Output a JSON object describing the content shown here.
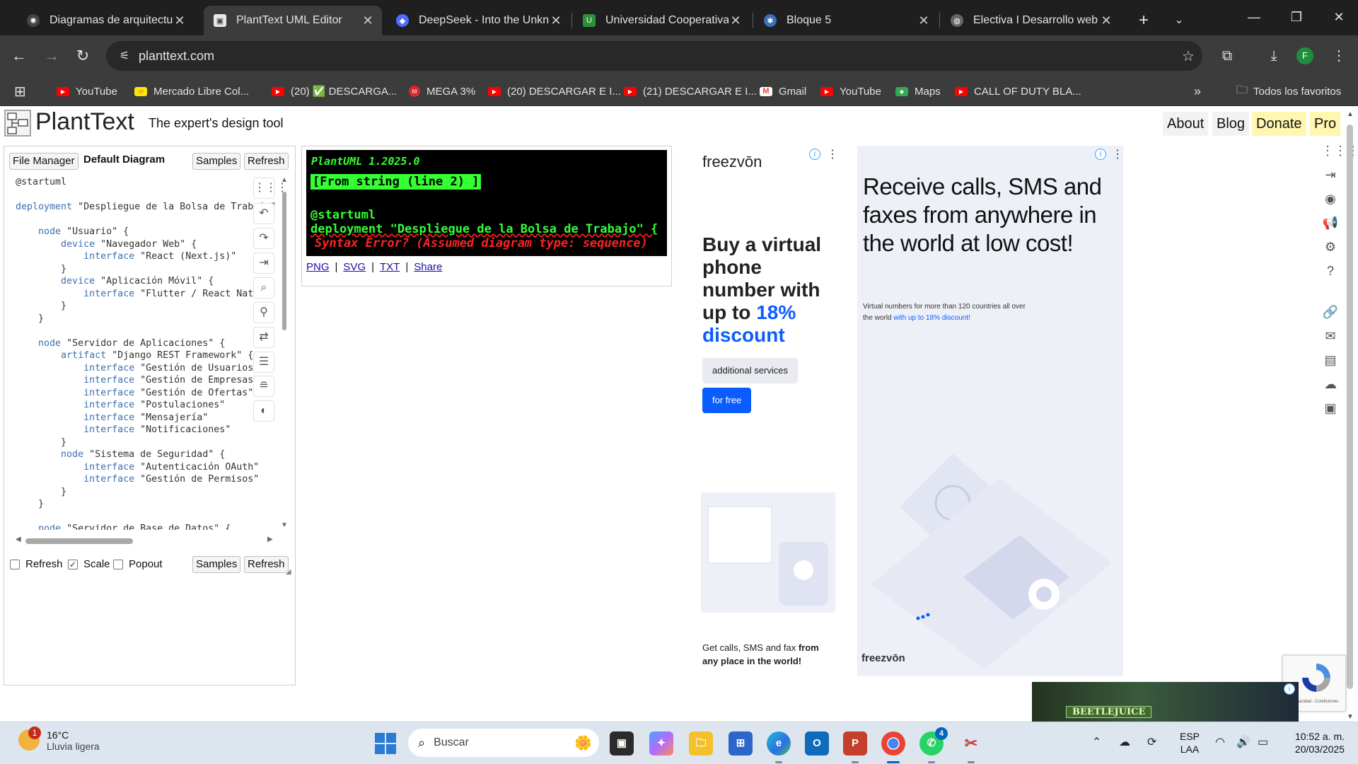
{
  "browser": {
    "tabs": [
      {
        "title": "Diagramas de arquitectura",
        "active": false
      },
      {
        "title": "PlantText UML Editor",
        "active": true
      },
      {
        "title": "DeepSeek - Into the Unknown",
        "active": false
      },
      {
        "title": "Universidad Cooperativa de Colombia",
        "active": false
      },
      {
        "title": "Bloque 5",
        "active": false
      },
      {
        "title": "Electiva I Desarrollo web",
        "active": false
      }
    ],
    "url": "planttext.com",
    "profile_initial": "F",
    "bookmarks": [
      {
        "label": "YouTube",
        "icon": "youtube-icon"
      },
      {
        "label": "Mercado Libre Col...",
        "icon": "mercadolibre-icon"
      },
      {
        "label": "(20) ✅ DESCARGA...",
        "icon": "youtube-icon"
      },
      {
        "label": "MEGA 3%",
        "icon": "mega-icon"
      },
      {
        "label": "(20) DESCARGAR E I...",
        "icon": "youtube-icon"
      },
      {
        "label": "(21) DESCARGAR E I...",
        "icon": "youtube-icon"
      },
      {
        "label": "Gmail",
        "icon": "gmail-icon"
      },
      {
        "label": "YouTube",
        "icon": "youtube-icon"
      },
      {
        "label": "Maps",
        "icon": "maps-icon"
      },
      {
        "label": "CALL OF DUTY BLA...",
        "icon": "youtube-icon"
      }
    ],
    "all_bookmarks": "Todos los favoritos"
  },
  "site": {
    "brand": "PlantText",
    "tagline": "The expert's design tool",
    "nav": [
      "About",
      "Blog",
      "Donate",
      "Pro"
    ]
  },
  "editor": {
    "file_manager": "File Manager",
    "diagram_name": "Default Diagram",
    "samples": "Samples",
    "refresh": "Refresh",
    "code_lines": [
      "@startuml",
      "",
      "deployment \"Despliegue de la Bolsa de Trabajo\" {",
      "",
      "    node \"Usuario\" {",
      "        device \"Navegador Web\" {",
      "            interface \"React (Next.js)\"",
      "        }",
      "        device \"Aplicación Móvil\" {",
      "            interface \"Flutter / React Native\"",
      "        }",
      "    }",
      "",
      "    node \"Servidor de Aplicaciones\" {",
      "        artifact \"Django REST Framework\" {",
      "            interface \"Gestión de Usuarios\"",
      "            interface \"Gestión de Empresas\"",
      "            interface \"Gestión de Ofertas\"",
      "            interface \"Postulaciones\"",
      "            interface \"Mensajería\"",
      "            interface \"Notificaciones\"",
      "        }",
      "        node \"Sistema de Seguridad\" {",
      "            interface \"Autenticación OAuth\"",
      "            interface \"Gestión de Permisos\"",
      "        }",
      "    }",
      "",
      "    node \"Servidor de Base de Datos\" {"
    ],
    "checkboxes": [
      {
        "label": "Refresh",
        "checked": false
      },
      {
        "label": "Scale",
        "checked": true
      },
      {
        "label": "Popout",
        "checked": false
      }
    ],
    "bottom_samples": "Samples",
    "bottom_refresh": "Refresh"
  },
  "output": {
    "version": "PlantUML 1.2025.0",
    "source": "[From string (line 2) ]",
    "line1": "@startuml",
    "line2": "deployment \"Despliegue de la Bolsa de Trabajo\" {",
    "line3": " Syntax Error? (Assumed diagram type: sequence)",
    "links": [
      "PNG",
      "SVG",
      "TXT",
      "Share"
    ]
  },
  "ads": {
    "ad1": {
      "brand": "freezvōn",
      "headline": "Buy a virtual phone number with up to",
      "headline_accent": "18% discount",
      "btn1": "additional services",
      "btn2": "for free",
      "footer_plain": "Get calls, SMS and fax ",
      "footer_bold": "from any place in the world!"
    },
    "ad2": {
      "headline": "Receive calls, SMS and faxes from anywhere in the world at low cost!",
      "sub_plain": "Virtual numbers for more than 120 countries all over the world ",
      "sub_accent": "with up to 18% discount!",
      "brand": "freezvōn"
    },
    "banner_text": "BEETLEJUICE",
    "recaptcha_text": "Privacidad - Condiciones"
  },
  "taskbar": {
    "temperature": "16°C",
    "weather": "Lluvia ligera",
    "weather_badge": "1",
    "search_placeholder": "Buscar",
    "lang_line1": "ESP",
    "lang_line2": "LAA",
    "time": "10:52 a. m.",
    "date": "20/03/2025",
    "whatsapp_badge": "4"
  },
  "colors": {
    "accent_blue": "#0b5cff",
    "error_green": "#33ff33",
    "error_red": "#ff2222",
    "donate_bg": "#fff6b0"
  }
}
